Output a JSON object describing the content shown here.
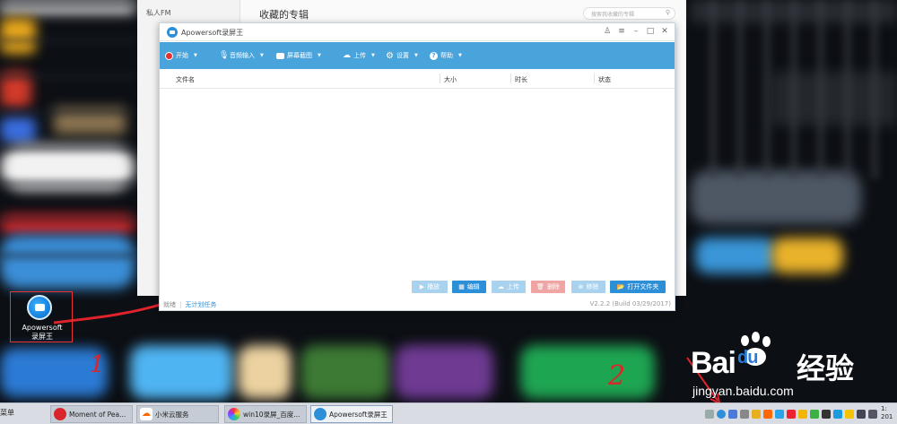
{
  "music_app": {
    "side_item": "私人FM",
    "section_title": "收藏的专辑",
    "search_placeholder": "搜索我收藏的专辑"
  },
  "desktop": {
    "icon_label": "Apowersoft\n录屏王"
  },
  "annotations": {
    "one": "1",
    "two": "2"
  },
  "watermark": {
    "logo": "Bai",
    "logo_du": "du",
    "logo_cn": "经验",
    "url": "jingyan.baidu.com"
  },
  "window": {
    "title": "Apowersoft录屏王",
    "toolbar": {
      "start": "开始",
      "audio_input": "音频输入",
      "screenshot": "屏幕截图",
      "upload": "上传",
      "settings": "设置",
      "help": "帮助"
    },
    "table": {
      "columns": [
        "文件名",
        "大小",
        "时长",
        "状态"
      ],
      "rows": []
    },
    "actions": {
      "play": "播放",
      "edit": "编辑",
      "upload": "上传",
      "delete": "删除",
      "remove": "移除",
      "open_folder": "打开文件夹"
    },
    "status": {
      "state": "就绪",
      "task": "无计划任务",
      "version": "V2.2.2 (Build 03/29/2017)"
    }
  },
  "taskbar": {
    "start": "菜单",
    "items": [
      {
        "label": "Moment of Pea..."
      },
      {
        "label": "小米云服务"
      },
      {
        "label": "win10录屏_百度..."
      },
      {
        "label": "Apowersoft录屏王"
      }
    ],
    "clock": "1:\n201"
  },
  "colors": {
    "toolbar_blue": "#4aa4dc",
    "button_blue": "#2d8fd8",
    "button_disabled_blue": "#a9d2ef",
    "button_disabled_red": "#f0a5a5",
    "annotation_red": "#e0232a"
  }
}
